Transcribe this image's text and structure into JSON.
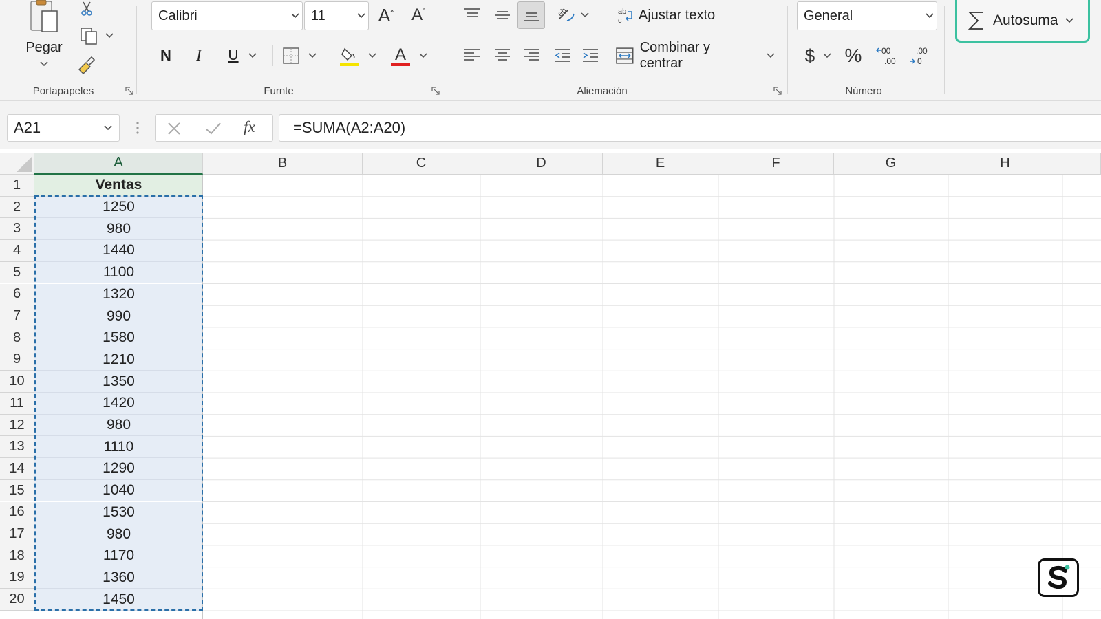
{
  "ribbon": {
    "clipboard": {
      "paste_label": "Pegar",
      "group_label": "Portapapeles"
    },
    "font": {
      "font_name": "Calibri",
      "font_size": "11",
      "group_label": "Furnte",
      "bold_label": "N",
      "italic_label": "I",
      "underline_label": "U",
      "highlight_color": "#f5e400",
      "font_color": "#e02020"
    },
    "alignment": {
      "wrap_text_label": "Ajustar texto",
      "merge_center_label": "Combinar y centrar",
      "group_label": "Aliemación"
    },
    "number": {
      "format_value": "General",
      "currency_symbol": "$",
      "percent_symbol": "%",
      "group_label": "Número"
    },
    "autosum": {
      "label": "Autosuma",
      "accent": "#3cc1a0"
    }
  },
  "formula_bar": {
    "name_box": "A21",
    "formula": "=SUMA(A2:A20)"
  },
  "sheet": {
    "columns": [
      "A",
      "B",
      "C",
      "D",
      "E",
      "F",
      "G",
      "H"
    ],
    "rows": [
      "1",
      "2",
      "3",
      "4",
      "5",
      "6",
      "7",
      "8",
      "9",
      "10",
      "11",
      "12",
      "13",
      "14",
      "15",
      "16",
      "17",
      "18",
      "19",
      "20"
    ],
    "column_a": [
      "Ventas",
      "1250",
      "980",
      "1440",
      "1100",
      "1320",
      "990",
      "1580",
      "1210",
      "1350",
      "1420",
      "980",
      "1110",
      "1290",
      "1040",
      "1530",
      "980",
      "1170",
      "1360",
      "1450"
    ],
    "header_fill": "#e2efe3",
    "selection_fill": "#e6edf6",
    "accent_green": "#217346"
  }
}
